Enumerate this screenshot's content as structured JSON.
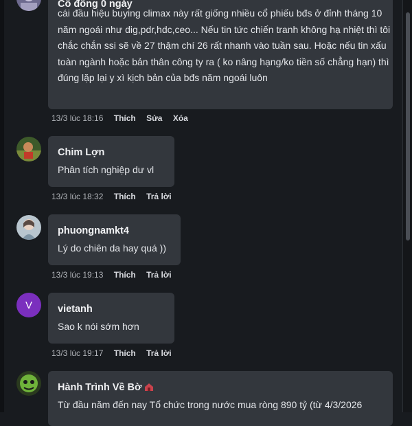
{
  "comments": [
    {
      "author": "Cổ đông 0 ngày",
      "text": "cái đầu hiệu buying climax này rất giống nhiều cổ phiếu bđs ở đỉnh tháng 10 năm ngoái như dig,pdr,hdc,ceo... Nếu tin tức chiến tranh không hạ nhiệt thì tôi chắc chắn ssi sẽ về 27 thậm chí 26 rất nhanh vào tuần sau. Hoặc nếu tin xấu toàn ngành hoặc bản thân công ty ra ( ko nâng hạng/ko tiền số chẳng hạn) thì đúng lặp lại y xì kịch bản của bđs năm ngoái luôn",
      "time": "13/3 lúc 18:16",
      "actions": [
        "Thích",
        "Sửa",
        "Xóa"
      ]
    },
    {
      "author": "Chim Lợn",
      "text": "Phân tích nghiệp dư vl",
      "time": "13/3 lúc 18:32",
      "actions": [
        "Thích",
        "Trả lời"
      ]
    },
    {
      "author": "phuongnamkt4",
      "text": "Lý do chiên da hay quá ))",
      "time": "13/3 lúc 19:13",
      "actions": [
        "Thích",
        "Trả lời"
      ]
    },
    {
      "author": "vietanh",
      "avatar_letter": "V",
      "avatar_color": "#7b2fbe",
      "text": "Sao k nói sớm hơn",
      "time": "13/3 lúc 19:17",
      "actions": [
        "Thích",
        "Trả lời"
      ]
    },
    {
      "author": "Hành Trình Về Bờ",
      "text": "Từ đầu năm đến nay Tổ chức trong nước mua ròng 890 tỷ (từ 4/3/2026"
    }
  ],
  "theme": {
    "background": "#181b1f",
    "bubble": "#33373d",
    "meta_text": "#b0b3b8"
  }
}
